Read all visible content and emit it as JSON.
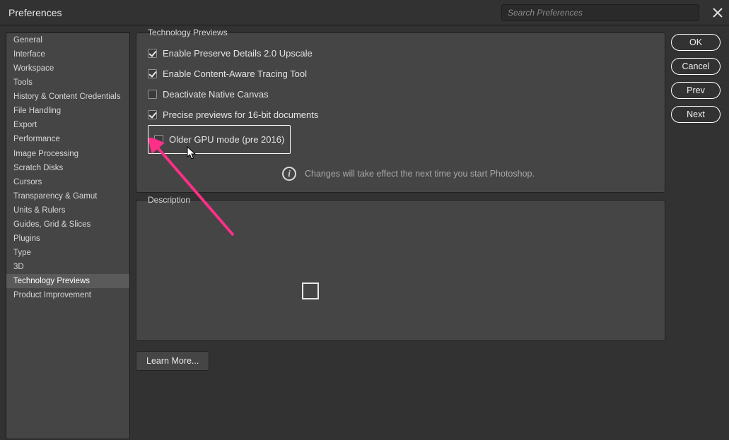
{
  "window": {
    "title": "Preferences",
    "search_placeholder": "Search Preferences"
  },
  "sidebar": {
    "items": [
      "General",
      "Interface",
      "Workspace",
      "Tools",
      "History & Content Credentials",
      "File Handling",
      "Export",
      "Performance",
      "Image Processing",
      "Scratch Disks",
      "Cursors",
      "Transparency & Gamut",
      "Units & Rulers",
      "Guides, Grid & Slices",
      "Plugins",
      "Type",
      "3D",
      "Technology Previews",
      "Product Improvement"
    ],
    "selected_index": 17
  },
  "main": {
    "group_title": "Technology Previews",
    "options": [
      {
        "label": "Enable Preserve Details 2.0 Upscale",
        "checked": true,
        "highlighted": false
      },
      {
        "label": "Enable Content-Aware Tracing Tool",
        "checked": true,
        "highlighted": false
      },
      {
        "label": "Deactivate Native Canvas",
        "checked": false,
        "highlighted": false
      },
      {
        "label": "Precise previews for 16-bit documents",
        "checked": true,
        "highlighted": false
      },
      {
        "label": "Older GPU mode (pre 2016)",
        "checked": false,
        "highlighted": true
      }
    ],
    "info_text": "Changes will take effect the next time you start Photoshop.",
    "desc_title": "Description",
    "learn_more": "Learn More..."
  },
  "buttons": {
    "ok": "OK",
    "cancel": "Cancel",
    "prev": "Prev",
    "next": "Next"
  }
}
